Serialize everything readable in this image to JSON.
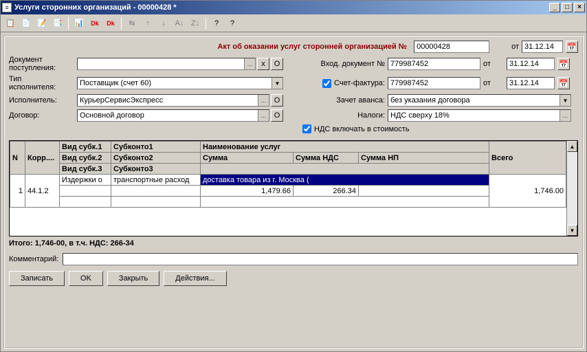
{
  "window": {
    "title": "Услуги сторонних организаций - 00000428 *",
    "min": "_",
    "max": "□",
    "close": "×"
  },
  "toolbar_icons": [
    "📋",
    "📄",
    "📝",
    "📑",
    "📊",
    "Dk",
    "Dk",
    "⇆",
    "↑",
    "↓",
    "A↓",
    "Z↓",
    "?",
    "?"
  ],
  "headline": "Акт об оказании услуг сторонней организацией №",
  "header": {
    "doc_no": "00000428",
    "ot": "от",
    "date1": "31.12.14",
    "receipt_lbl": "Документ\nпоступления:",
    "receipt_val": "",
    "x": "х",
    "o": "О",
    "incoming_lbl": "Вход. документ №",
    "incoming_val": "779987452",
    "date2": "31.12.14",
    "type_lbl": "Тип\nисполнителя:",
    "type_val": "Поставщик (счет 60)",
    "sf_chk_lbl": "Счет-фактура:",
    "sf_val": "779987452",
    "date3": "31.12.14",
    "exec_lbl": "Исполнитель:",
    "exec_val": "КурьерСервисЭкспресс",
    "avans_lbl": "Зачет аванса:",
    "avans_val": "без указания договора",
    "dogovor_lbl": "Договор:",
    "dogovor_val": "Основной договор",
    "nalogi_lbl": "Налоги:",
    "nalogi_val": "НДС сверху 18%",
    "nds_incl_lbl": "НДС включать в стоимость"
  },
  "table": {
    "cols": {
      "n": "N",
      "korr": "Корр....",
      "vid1": "Вид субк.1",
      "sub1": "Субконто1",
      "naim": "Наименование услуг",
      "vsego": "Всего",
      "vid2": "Вид субк.2",
      "sub2": "Субконто2",
      "summa": "Сумма",
      "snds": "Сумма НДС",
      "snp": "Сумма НП",
      "vid3": "Вид субк.3",
      "sub3": "Субконто3"
    },
    "row": {
      "n": "1",
      "korr": "44.1.2",
      "vid1": "Издержки о",
      "sub1": "транспортные расход",
      "naim": "доставка товара из г. Москва (",
      "vsego": "1,746.00",
      "summa": "1,479.66",
      "snds": "266.34",
      "snp": ""
    }
  },
  "totals": "Итого: 1,746-00, в т.ч. НДС: 266-34",
  "comment_lbl": "Комментарий:",
  "comment_val": "",
  "buttons": {
    "save": "Записать",
    "ok": "OK",
    "close": "Закрыть",
    "actions": "Действия..."
  }
}
